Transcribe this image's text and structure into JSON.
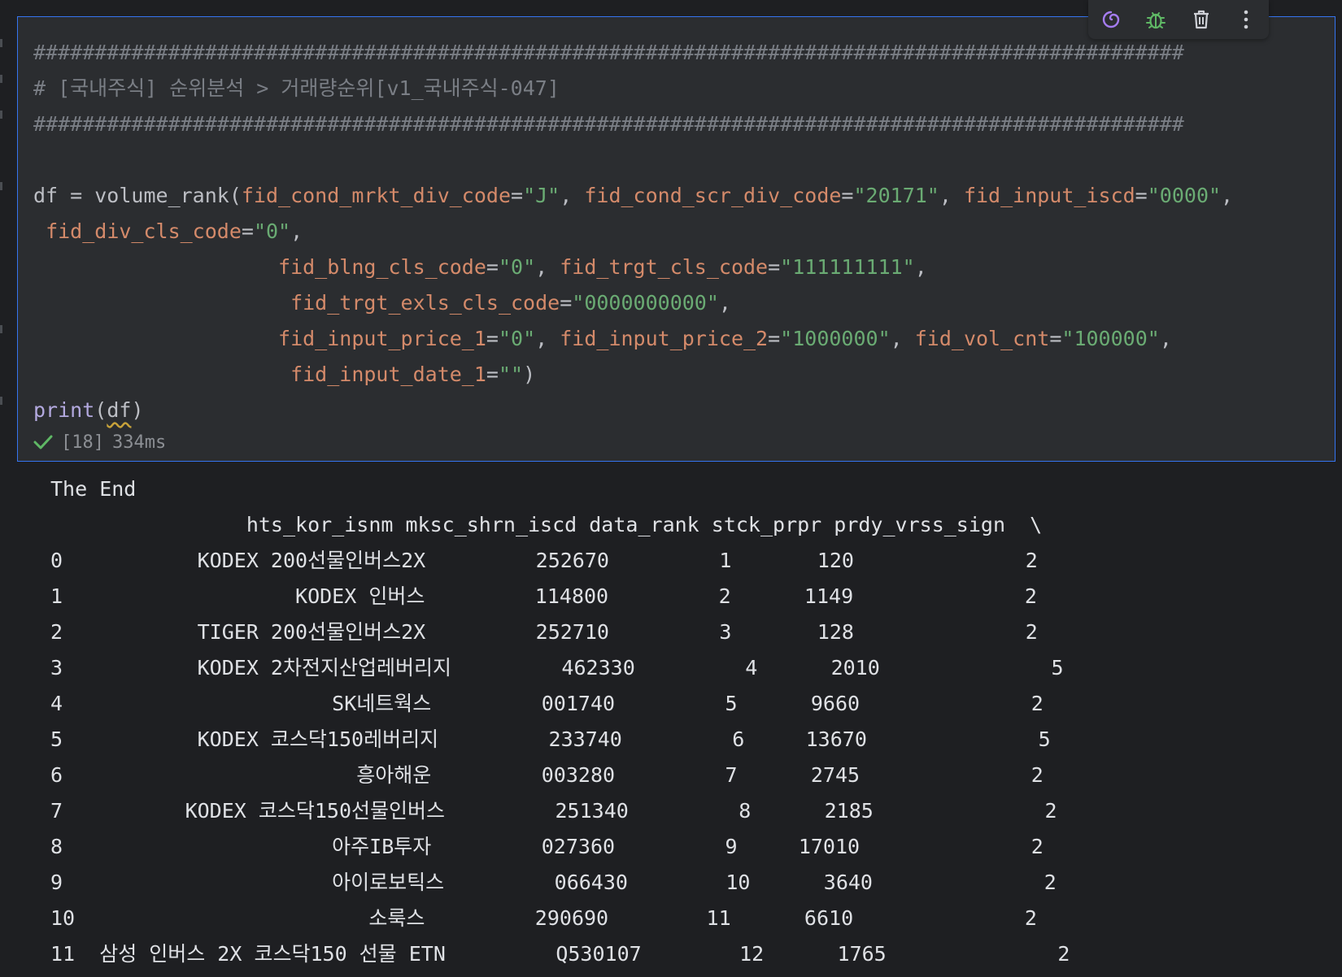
{
  "toolbar": {
    "items": [
      {
        "name": "ai-assistant-icon"
      },
      {
        "name": "debug-icon"
      },
      {
        "name": "delete-icon"
      },
      {
        "name": "more-icon"
      }
    ]
  },
  "code": {
    "comment_hash": "##############################################################################################",
    "comment_title": "# [국내주식] 순위분석 > 거래량순위[v1_국내주식-047]",
    "l5": {
      "pre": "df = volume_rank(",
      "a1": "fid_cond_mrkt_div_code",
      "v1": "\"J\"",
      "a2": "fid_cond_scr_div_code",
      "v2": "\"20171\"",
      "a3": "fid_input_iscd",
      "v3": "\"0000\""
    },
    "l6": {
      "a1": "fid_div_cls_code",
      "v1": "\"0\""
    },
    "l7": {
      "a1": "fid_blng_cls_code",
      "v1": "\"0\"",
      "a2": "fid_trgt_cls_code",
      "v2": "\"111111111\""
    },
    "l8": {
      "a1": "fid_trgt_exls_cls_code",
      "v1": "\"0000000000\""
    },
    "l9": {
      "a1": "fid_input_price_1",
      "v1": "\"0\"",
      "a2": "fid_input_price_2",
      "v2": "\"1000000\"",
      "a3": "fid_vol_cnt",
      "v3": "\"100000\""
    },
    "l10": {
      "a1": "fid_input_date_1",
      "v1": "\"\""
    },
    "l11": {
      "fn": "print",
      "arg": "df"
    }
  },
  "exec": {
    "count": "[18]",
    "time": "334ms"
  },
  "output": [
    "The End",
    "                hts_kor_isnm mksc_shrn_iscd data_rank stck_prpr prdy_vrss_sign  \\",
    "0           KODEX 200선물인버스2X         252670         1       120              2",
    "1                   KODEX 인버스         114800         2      1149              2",
    "2           TIGER 200선물인버스2X         252710         3       128              2",
    "3           KODEX 2차전지산업레버리지         462330         4      2010              5",
    "4                      SK네트웍스         001740         5      9660              2",
    "5           KODEX 코스닥150레버리지         233740         6     13670              5",
    "6                        흥아해운         003280         7      2745              2",
    "7          KODEX 코스닥150선물인버스         251340         8      2185              2",
    "8                      아주IB투자         027360         9     17010              2",
    "9                      아이로보틱스         066430        10      3640              2",
    "10                        소룩스         290690        11      6610              2",
    "11  삼성 인버스 2X 코스닥150 선물 ETN         Q530107        12      1765              2"
  ]
}
